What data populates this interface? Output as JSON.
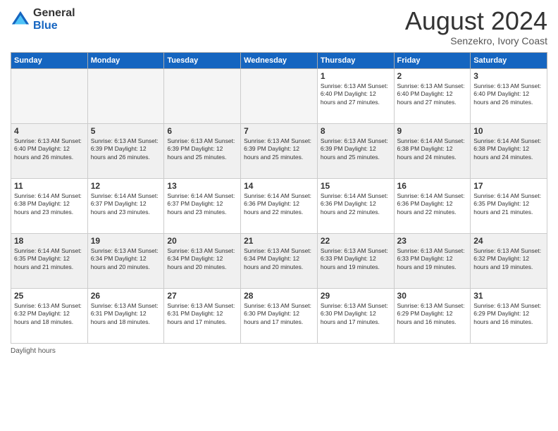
{
  "logo": {
    "general": "General",
    "blue": "Blue"
  },
  "title": "August 2024",
  "subtitle": "Senzekro, Ivory Coast",
  "footer": "Daylight hours",
  "headers": [
    "Sunday",
    "Monday",
    "Tuesday",
    "Wednesday",
    "Thursday",
    "Friday",
    "Saturday"
  ],
  "weeks": [
    [
      {
        "day": "",
        "info": "",
        "empty": true
      },
      {
        "day": "",
        "info": "",
        "empty": true
      },
      {
        "day": "",
        "info": "",
        "empty": true
      },
      {
        "day": "",
        "info": "",
        "empty": true
      },
      {
        "day": "1",
        "info": "Sunrise: 6:13 AM\nSunset: 6:40 PM\nDaylight: 12 hours\nand 27 minutes."
      },
      {
        "day": "2",
        "info": "Sunrise: 6:13 AM\nSunset: 6:40 PM\nDaylight: 12 hours\nand 27 minutes."
      },
      {
        "day": "3",
        "info": "Sunrise: 6:13 AM\nSunset: 6:40 PM\nDaylight: 12 hours\nand 26 minutes."
      }
    ],
    [
      {
        "day": "4",
        "info": "Sunrise: 6:13 AM\nSunset: 6:40 PM\nDaylight: 12 hours\nand 26 minutes."
      },
      {
        "day": "5",
        "info": "Sunrise: 6:13 AM\nSunset: 6:39 PM\nDaylight: 12 hours\nand 26 minutes."
      },
      {
        "day": "6",
        "info": "Sunrise: 6:13 AM\nSunset: 6:39 PM\nDaylight: 12 hours\nand 25 minutes."
      },
      {
        "day": "7",
        "info": "Sunrise: 6:13 AM\nSunset: 6:39 PM\nDaylight: 12 hours\nand 25 minutes."
      },
      {
        "day": "8",
        "info": "Sunrise: 6:13 AM\nSunset: 6:39 PM\nDaylight: 12 hours\nand 25 minutes."
      },
      {
        "day": "9",
        "info": "Sunrise: 6:14 AM\nSunset: 6:38 PM\nDaylight: 12 hours\nand 24 minutes."
      },
      {
        "day": "10",
        "info": "Sunrise: 6:14 AM\nSunset: 6:38 PM\nDaylight: 12 hours\nand 24 minutes."
      }
    ],
    [
      {
        "day": "11",
        "info": "Sunrise: 6:14 AM\nSunset: 6:38 PM\nDaylight: 12 hours\nand 23 minutes."
      },
      {
        "day": "12",
        "info": "Sunrise: 6:14 AM\nSunset: 6:37 PM\nDaylight: 12 hours\nand 23 minutes."
      },
      {
        "day": "13",
        "info": "Sunrise: 6:14 AM\nSunset: 6:37 PM\nDaylight: 12 hours\nand 23 minutes."
      },
      {
        "day": "14",
        "info": "Sunrise: 6:14 AM\nSunset: 6:36 PM\nDaylight: 12 hours\nand 22 minutes."
      },
      {
        "day": "15",
        "info": "Sunrise: 6:14 AM\nSunset: 6:36 PM\nDaylight: 12 hours\nand 22 minutes."
      },
      {
        "day": "16",
        "info": "Sunrise: 6:14 AM\nSunset: 6:36 PM\nDaylight: 12 hours\nand 22 minutes."
      },
      {
        "day": "17",
        "info": "Sunrise: 6:14 AM\nSunset: 6:35 PM\nDaylight: 12 hours\nand 21 minutes."
      }
    ],
    [
      {
        "day": "18",
        "info": "Sunrise: 6:14 AM\nSunset: 6:35 PM\nDaylight: 12 hours\nand 21 minutes."
      },
      {
        "day": "19",
        "info": "Sunrise: 6:13 AM\nSunset: 6:34 PM\nDaylight: 12 hours\nand 20 minutes."
      },
      {
        "day": "20",
        "info": "Sunrise: 6:13 AM\nSunset: 6:34 PM\nDaylight: 12 hours\nand 20 minutes."
      },
      {
        "day": "21",
        "info": "Sunrise: 6:13 AM\nSunset: 6:34 PM\nDaylight: 12 hours\nand 20 minutes."
      },
      {
        "day": "22",
        "info": "Sunrise: 6:13 AM\nSunset: 6:33 PM\nDaylight: 12 hours\nand 19 minutes."
      },
      {
        "day": "23",
        "info": "Sunrise: 6:13 AM\nSunset: 6:33 PM\nDaylight: 12 hours\nand 19 minutes."
      },
      {
        "day": "24",
        "info": "Sunrise: 6:13 AM\nSunset: 6:32 PM\nDaylight: 12 hours\nand 19 minutes."
      }
    ],
    [
      {
        "day": "25",
        "info": "Sunrise: 6:13 AM\nSunset: 6:32 PM\nDaylight: 12 hours\nand 18 minutes."
      },
      {
        "day": "26",
        "info": "Sunrise: 6:13 AM\nSunset: 6:31 PM\nDaylight: 12 hours\nand 18 minutes."
      },
      {
        "day": "27",
        "info": "Sunrise: 6:13 AM\nSunset: 6:31 PM\nDaylight: 12 hours\nand 17 minutes."
      },
      {
        "day": "28",
        "info": "Sunrise: 6:13 AM\nSunset: 6:30 PM\nDaylight: 12 hours\nand 17 minutes."
      },
      {
        "day": "29",
        "info": "Sunrise: 6:13 AM\nSunset: 6:30 PM\nDaylight: 12 hours\nand 17 minutes."
      },
      {
        "day": "30",
        "info": "Sunrise: 6:13 AM\nSunset: 6:29 PM\nDaylight: 12 hours\nand 16 minutes."
      },
      {
        "day": "31",
        "info": "Sunrise: 6:13 AM\nSunset: 6:29 PM\nDaylight: 12 hours\nand 16 minutes."
      }
    ]
  ]
}
